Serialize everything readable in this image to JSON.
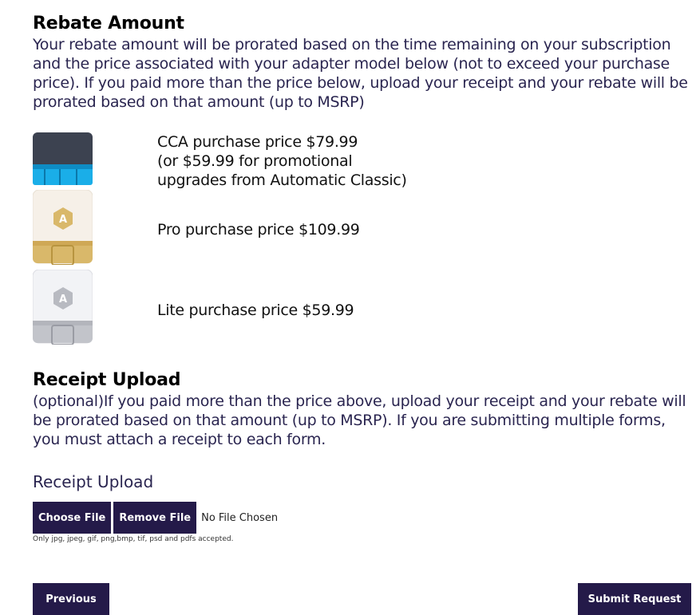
{
  "rebate": {
    "title": "Rebate Amount",
    "description": "Your rebate amount will be prorated based on the time remaining on your subscription and the price associated with your adapter model below (not to exceed your purchase price). If you paid more than the price below, upload your receipt and your rebate will be prorated based on that amount (up to MSRP)"
  },
  "adapters": [
    {
      "icon": "cca-adapter-icon",
      "line1": "CCA purchase price $79.99",
      "line2": "(or $59.99 for promotional",
      "line3": "upgrades from Automatic Classic)",
      "color": "#1aaee8"
    },
    {
      "icon": "pro-adapter-icon",
      "line1": "Pro purchase price $109.99",
      "color": "#d9b86a"
    },
    {
      "icon": "lite-adapter-icon",
      "line1": "Lite purchase price $59.99",
      "color": "#c2c4ca"
    }
  ],
  "receipt": {
    "title": "Receipt Upload",
    "description": "(optional)If you paid more than the price above, upload your receipt and your rebate will be prorated based on that amount (up to MSRP). If you are submitting multiple forms, you must attach a receipt to each form.",
    "field_label": "Receipt Upload",
    "choose_label": "Choose File",
    "remove_label": "Remove File",
    "status": "No File Chosen",
    "hint": "Only jpg, jpeg, gif, png,bmp, tif, psd and pdfs accepted."
  },
  "nav": {
    "previous_label": "Previous",
    "submit_label": "Submit Request"
  },
  "colors": {
    "button_bg": "#241a49",
    "text": "#2a2550"
  }
}
